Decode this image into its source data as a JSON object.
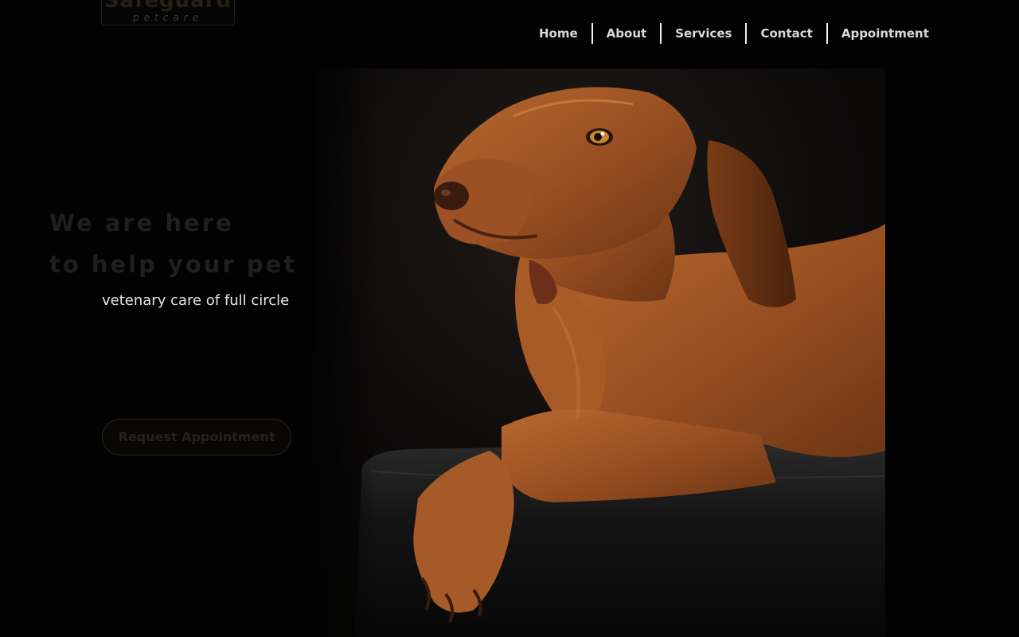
{
  "logo": {
    "name": "Safeguard",
    "subtitle": "petcare"
  },
  "nav": {
    "items": [
      {
        "label": "Home"
      },
      {
        "label": "About"
      },
      {
        "label": "Services"
      },
      {
        "label": "Contact"
      },
      {
        "label": "Appointment"
      }
    ]
  },
  "hero": {
    "headline_line1": "We are here",
    "headline_line2": "to help your pet",
    "subline": "vetenary care of full circle",
    "cta_label": "Request Appointment",
    "image": {
      "subject": "dog-photo",
      "dominant_colors": [
        "#a75a29",
        "#1a1a1a",
        "#0a0806"
      ]
    }
  }
}
